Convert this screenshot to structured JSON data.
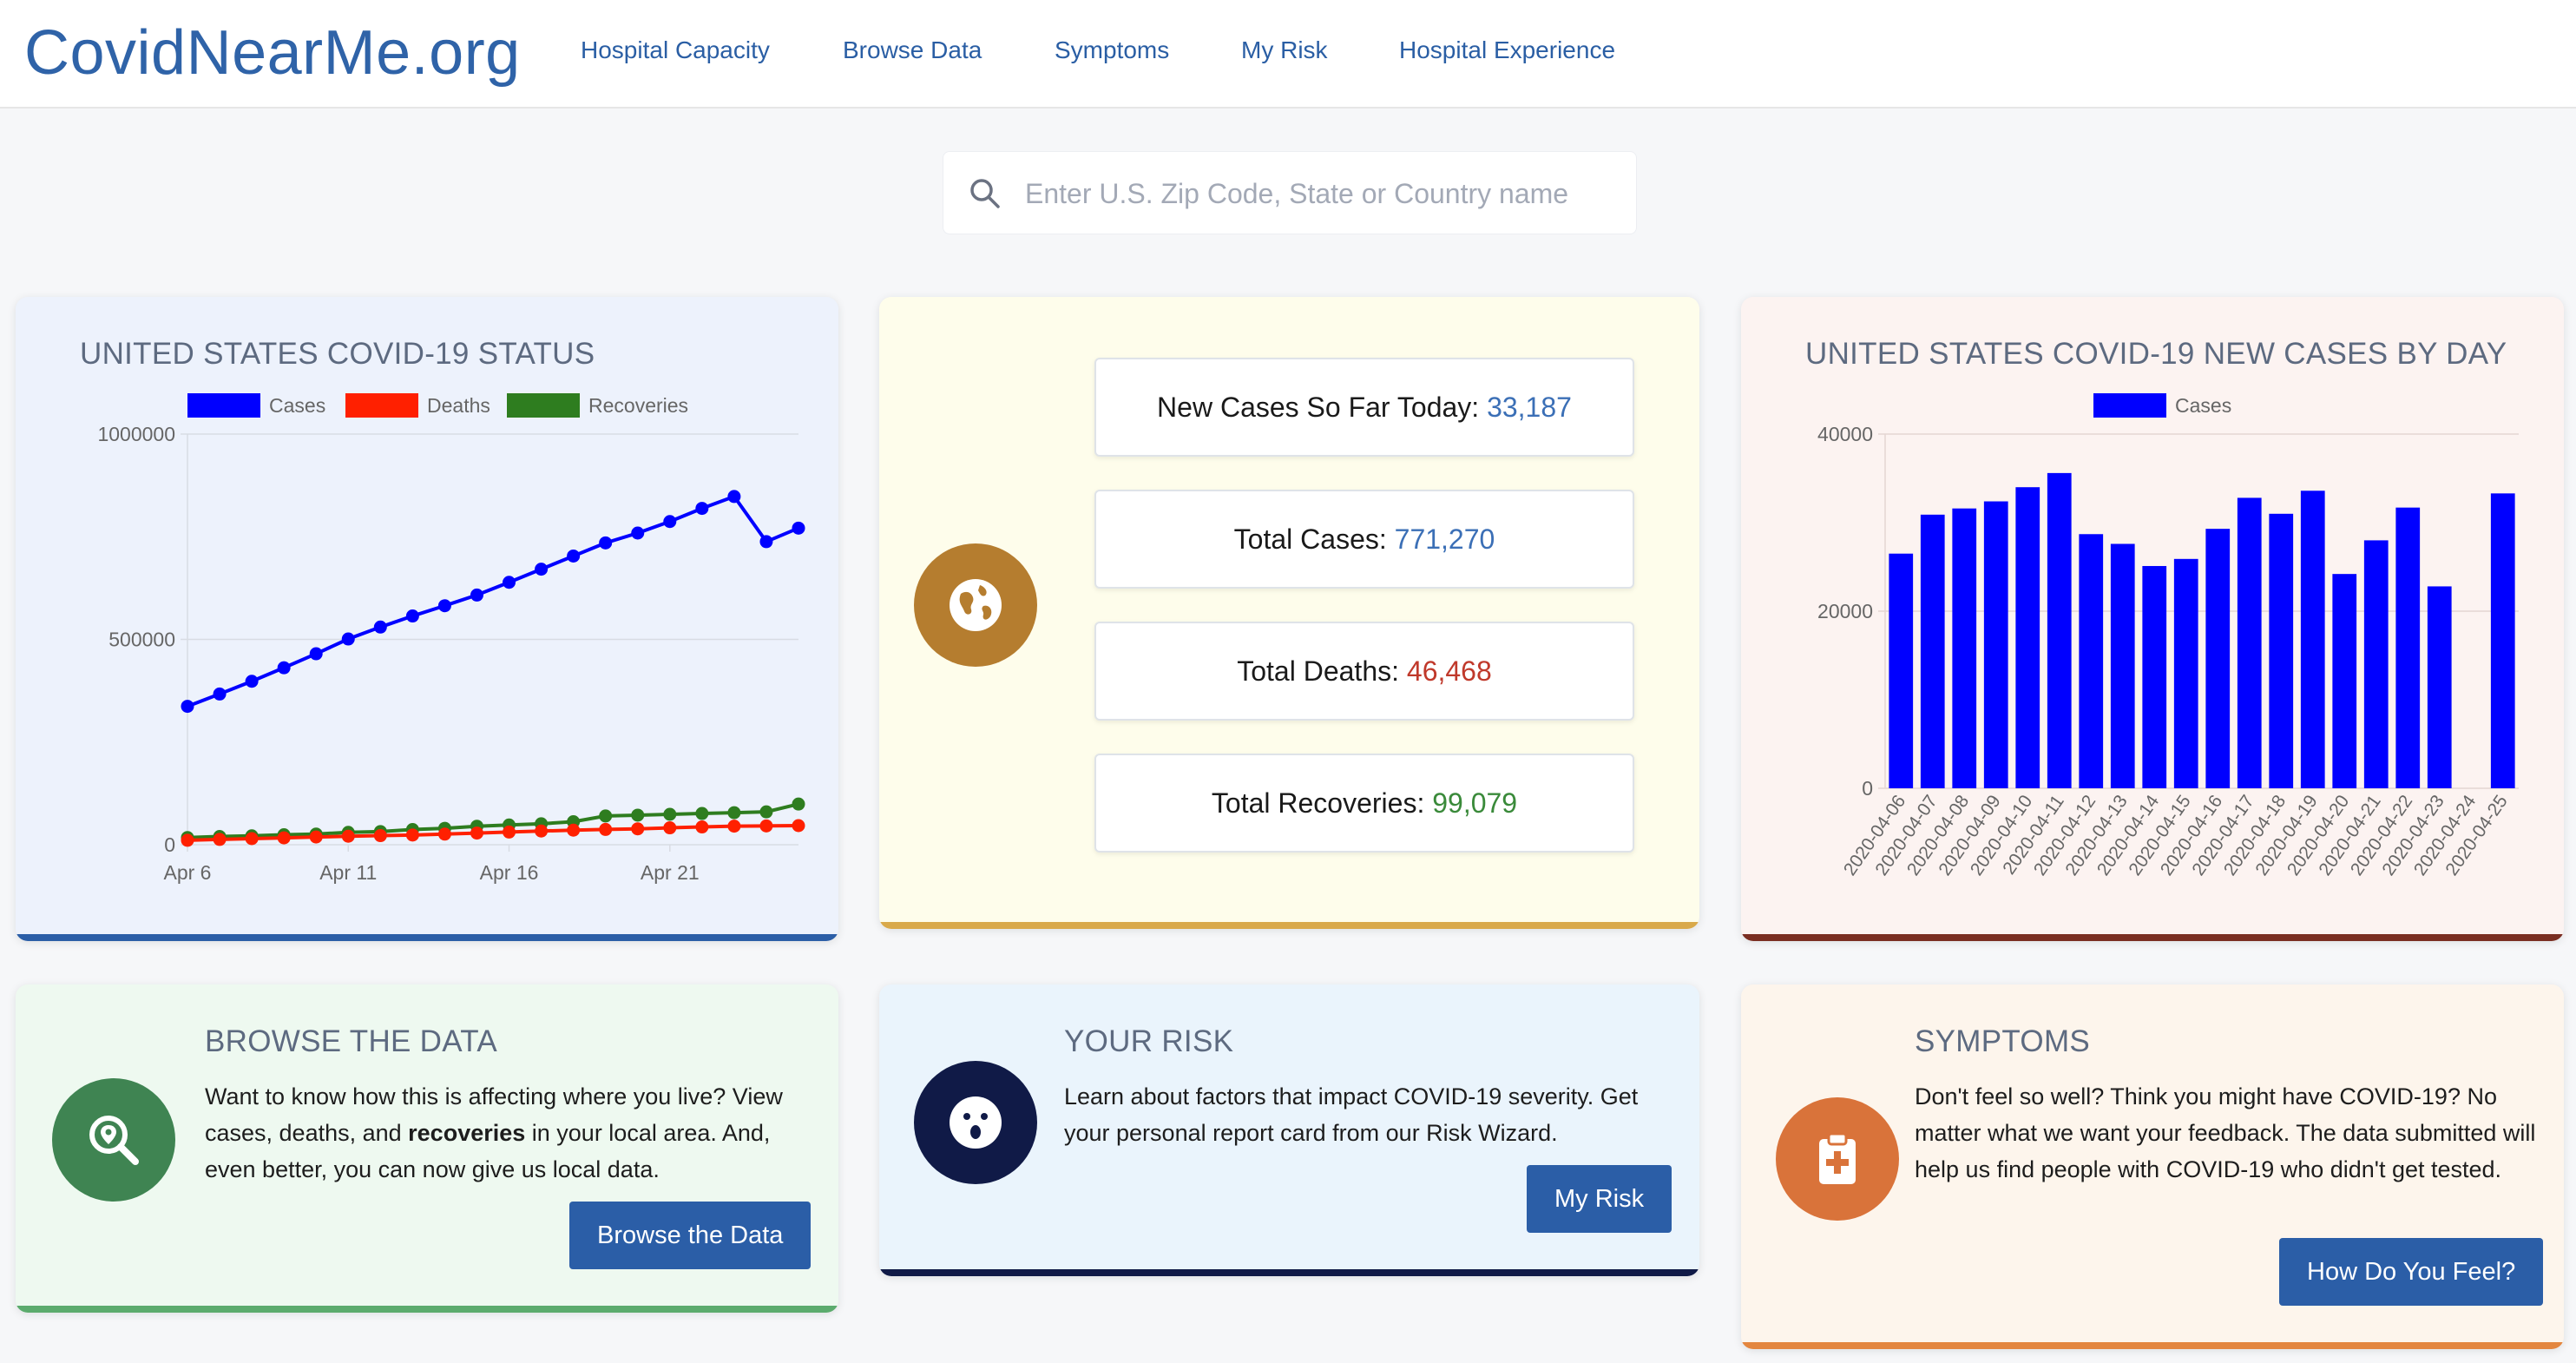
{
  "nav": {
    "logo": "CovidNearMe.org",
    "links": [
      "Hospital Capacity",
      "Browse Data",
      "Symptoms",
      "My Risk",
      "Hospital Experience"
    ]
  },
  "search": {
    "placeholder": "Enter U.S. Zip Code, State or Country name"
  },
  "status_card": {
    "title": "UNITED STATES COVID-19 STATUS"
  },
  "stats": {
    "new_cases_label": "New Cases So Far Today: ",
    "new_cases_value": "33,187",
    "total_cases_label": "Total Cases: ",
    "total_cases_value": "771,270",
    "total_deaths_label": "Total Deaths: ",
    "total_deaths_value": "46,468",
    "total_recoveries_label": "Total Recoveries: ",
    "total_recoveries_value": "99,079",
    "colors": {
      "cases": "#3b6fb6",
      "deaths": "#c0392b",
      "recoveries": "#3a8a3a"
    }
  },
  "newcases_card": {
    "title": "UNITED STATES COVID-19 NEW CASES BY DAY"
  },
  "browse": {
    "title": "BROWSE THE DATA",
    "text_1": "Want to know how this is affecting where you live? View cases, deaths, and ",
    "text_bold": "recoveries",
    "text_2": " in your local area. And, even better, you can now give us local data.",
    "button": "Browse the Data"
  },
  "risk": {
    "title": "YOUR RISK",
    "text": "Learn about factors that impact COVID-19 severity. Get your personal report card from our Risk Wizard.",
    "button": "My Risk"
  },
  "symptoms": {
    "title": "SYMPTOMS",
    "text": "Don't feel so well? Think you might have COVID-19? No matter what we want your feedback. The data submitted will help us find people with COVID-19 who didn't get tested.",
    "button": "How Do You Feel?"
  },
  "chart_data": [
    {
      "type": "line",
      "x": [
        "Apr 6",
        "Apr 7",
        "Apr 8",
        "Apr 9",
        "Apr 10",
        "Apr 11",
        "Apr 12",
        "Apr 13",
        "Apr 14",
        "Apr 15",
        "Apr 16",
        "Apr 17",
        "Apr 18",
        "Apr 19",
        "Apr 20",
        "Apr 21",
        "Apr 22",
        "Apr 23",
        "Apr 24",
        "Apr 25"
      ],
      "xticks": [
        "Apr 6",
        "Apr 11",
        "Apr 16",
        "Apr 21"
      ],
      "ylim": [
        0,
        1000000
      ],
      "yticks": [
        "0",
        "500000",
        "1000000"
      ],
      "legend": "top",
      "grid": true,
      "series": [
        {
          "name": "Cases",
          "color": "#0000ff",
          "values": [
            337000,
            367000,
            398000,
            431000,
            465000,
            501000,
            530000,
            557000,
            582000,
            608000,
            639000,
            671000,
            703000,
            735000,
            759000,
            787000,
            819000,
            848000,
            738000,
            771000
          ]
        },
        {
          "name": "Deaths",
          "color": "#ff2000",
          "values": [
            10800,
            12900,
            14800,
            16700,
            18800,
            20600,
            22100,
            23600,
            25800,
            28300,
            30900,
            33300,
            35400,
            37200,
            38700,
            41100,
            43300,
            45200,
            45800,
            46500
          ]
        },
        {
          "name": "Recoveries",
          "color": "#2e7d1f",
          "values": [
            17500,
            20000,
            21600,
            24200,
            26000,
            30000,
            32000,
            37000,
            40000,
            45000,
            48000,
            51000,
            56000,
            70000,
            72000,
            74000,
            76000,
            78000,
            80000,
            99000
          ]
        }
      ]
    },
    {
      "type": "bar",
      "categories": [
        "2020-04-06",
        "2020-04-07",
        "2020-04-08",
        "2020-04-09",
        "2020-04-10",
        "2020-04-11",
        "2020-04-12",
        "2020-04-13",
        "2020-04-14",
        "2020-04-15",
        "2020-04-16",
        "2020-04-17",
        "2020-04-18",
        "2020-04-19",
        "2020-04-20",
        "2020-04-21",
        "2020-04-22",
        "2020-04-23",
        "2020-04-24",
        "2020-04-25"
      ],
      "series": [
        {
          "name": "Cases",
          "color": "#0000ff",
          "values": [
            26500,
            30900,
            31600,
            32400,
            34000,
            35600,
            28700,
            27600,
            25100,
            25900,
            29300,
            32800,
            31000,
            33600,
            24200,
            28000,
            31700,
            22800,
            0,
            33300
          ]
        }
      ],
      "ylim": [
        0,
        40000
      ],
      "yticks": [
        "0",
        "20000",
        "40000"
      ],
      "legend": "top",
      "grid": true
    }
  ]
}
